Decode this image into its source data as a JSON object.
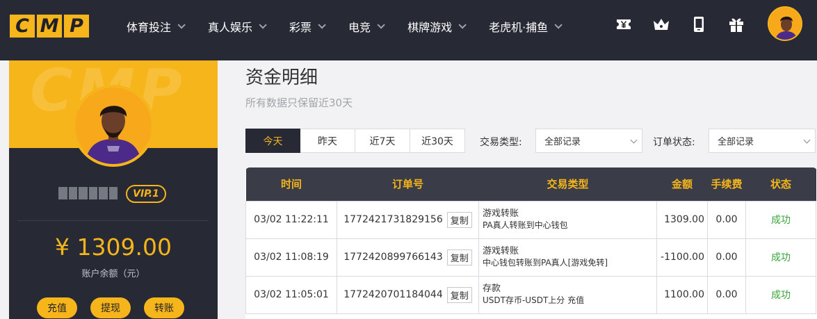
{
  "brand": {
    "letters": [
      "C",
      "M",
      "P"
    ]
  },
  "nav": [
    {
      "label": "体育投注"
    },
    {
      "label": "真人娱乐"
    },
    {
      "label": "彩票"
    },
    {
      "label": "电竞"
    },
    {
      "label": "棋牌游戏"
    },
    {
      "label": "老虎机·捕鱼"
    }
  ],
  "tools": [
    "yen-ticket-icon",
    "crown-icon",
    "mobile-icon",
    "gift-icon"
  ],
  "sidebar": {
    "vip": "VIP.1",
    "balance": "¥ 1309.00",
    "balance_label": "账户余额（元）",
    "buttons": [
      "充值",
      "提现",
      "转账"
    ]
  },
  "page": {
    "title": "资金明细",
    "subtitle": "所有数据只保留近30天"
  },
  "filters": {
    "ranges": [
      "今天",
      "昨天",
      "近7天",
      "近30天"
    ],
    "active_range": 0,
    "type_label": "交易类型:",
    "type_value": "全部记录",
    "status_label": "订单状态:",
    "status_value": "全部记录"
  },
  "table": {
    "headers": [
      "时间",
      "订单号",
      "交易类型",
      "金额",
      "手续费",
      "状态"
    ],
    "copy_label": "复制",
    "rows": [
      {
        "time": "03/02 11:22:11",
        "order": "1772421731829156",
        "type": "游戏转账",
        "desc": "PA真人转账到中心钱包",
        "amount": "1309.00",
        "fee": "0.00",
        "status": "成功"
      },
      {
        "time": "03/02 11:08:19",
        "order": "1772420899766143",
        "type": "游戏转账",
        "desc": "中心钱包转账到PA真人[游戏免转]",
        "amount": "-1100.00",
        "fee": "0.00",
        "status": "成功"
      },
      {
        "time": "03/02 11:05:01",
        "order": "1772420701184044",
        "type": "存款",
        "desc": "USDT存币-USDT上分 充值",
        "amount": "1100.00",
        "fee": "0.00",
        "status": "成功"
      }
    ]
  },
  "colors": {
    "accent": "#f6b51a",
    "dark": "#272a35",
    "success": "#3aa53a"
  }
}
